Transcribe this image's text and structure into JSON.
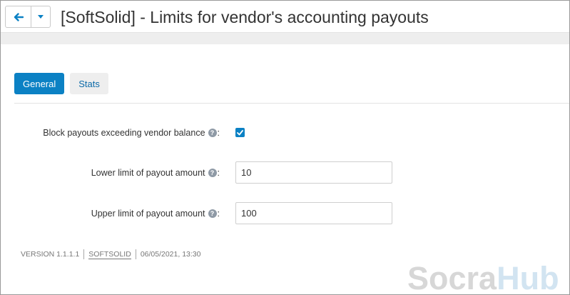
{
  "header": {
    "title": "[SoftSolid] - Limits for vendor's accounting payouts",
    "back_icon": "arrow-left-icon",
    "dropdown_icon": "caret-down-icon"
  },
  "tabs": [
    {
      "label": "General",
      "active": true
    },
    {
      "label": "Stats",
      "active": false
    }
  ],
  "form": {
    "block_payouts": {
      "label": "Block payouts exceeding vendor balance",
      "colon": ":",
      "checked": true
    },
    "lower_limit": {
      "label": "Lower limit of payout amount",
      "colon": ":",
      "value": "10"
    },
    "upper_limit": {
      "label": "Upper limit of payout amount",
      "colon": ":",
      "value": "100"
    }
  },
  "footer": {
    "version": "VERSION 1.1.1.1",
    "vendor": "SOFTSOLID",
    "date": "06/05/2021, 13:30"
  },
  "watermark": {
    "part1": "Socra",
    "part2": "Hub"
  },
  "colors": {
    "accent": "#0b81c4",
    "tab_inactive_bg": "#eeeeee",
    "text": "#333333"
  }
}
